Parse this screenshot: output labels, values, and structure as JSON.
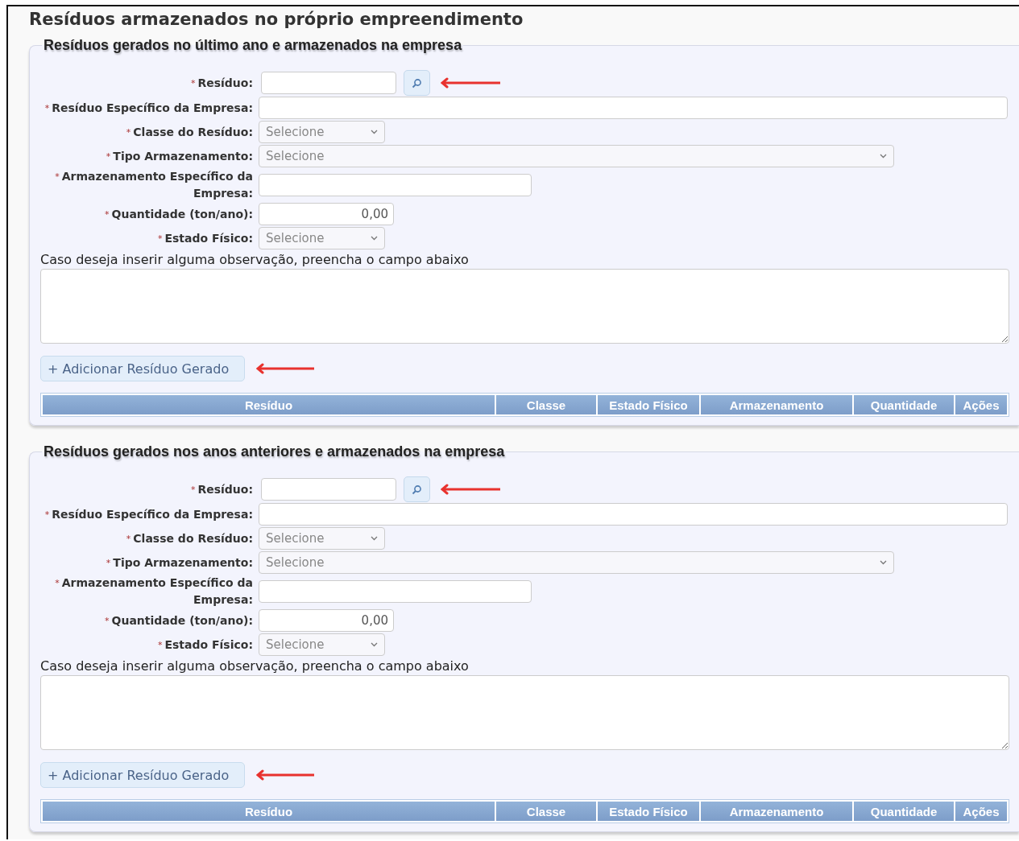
{
  "title": "Resíduos armazenados no próprio empreendimento",
  "sections": [
    {
      "legend": "Resíduos gerados no último ano e armazenados na empresa",
      "fields": [
        {
          "kind": "lookup",
          "label": "Resíduo:",
          "marker": "*"
        },
        {
          "kind": "text",
          "label": "Resíduo Específico da Empresa:",
          "marker": "*"
        },
        {
          "kind": "select",
          "label": "Classe do Resíduo:",
          "marker": "*",
          "placeholder": "Selecione"
        },
        {
          "kind": "select",
          "label": "Tipo Armazenamento:",
          "marker": "*",
          "placeholder": "Selecione"
        },
        {
          "kind": "text",
          "label": "Armazenamento Específico da Empresa:",
          "marker": "*"
        },
        {
          "kind": "number",
          "label": "Quantidade (ton/ano):",
          "marker": "*",
          "value": "0,00"
        },
        {
          "kind": "select",
          "label": "Estado Físico:",
          "marker": "*",
          "placeholder": "Selecione"
        }
      ],
      "note": "Caso deseja inserir alguma observação, preencha o campo abaixo",
      "add_button": "+ Adicionar Resíduo Gerado",
      "table": {
        "columns": [
          "Resíduo",
          "Classe",
          "Estado Físico",
          "Armazenamento",
          "Quantidade",
          "Ações"
        ]
      }
    },
    {
      "legend": "Resíduos gerados nos anos anteriores e armazenados na empresa",
      "fields": [
        {
          "kind": "lookup",
          "label": "Resíduo:",
          "marker": "*"
        },
        {
          "kind": "text",
          "label": "Resíduo Específico da Empresa:",
          "marker": "*"
        },
        {
          "kind": "select",
          "label": "Classe do Resíduo:",
          "marker": "*",
          "placeholder": "Selecione"
        },
        {
          "kind": "select",
          "label": "Tipo Armazenamento:",
          "marker": "*",
          "placeholder": "Selecione"
        },
        {
          "kind": "text",
          "label": "Armazenamento Específico da Empresa:",
          "marker": "*"
        },
        {
          "kind": "number",
          "label": "Quantidade (ton/ano):",
          "marker": "*",
          "value": "0,00"
        },
        {
          "kind": "select",
          "label": "Estado Físico:",
          "marker": "*",
          "placeholder": "Selecione"
        }
      ],
      "note": "Caso deseja inserir alguma observação, preencha o campo abaixo",
      "add_button": "+ Adicionar Resíduo Gerado",
      "table": {
        "columns": [
          "Resíduo",
          "Classe",
          "Estado Físico",
          "Armazenamento",
          "Quantidade",
          "Ações"
        ]
      }
    }
  ]
}
